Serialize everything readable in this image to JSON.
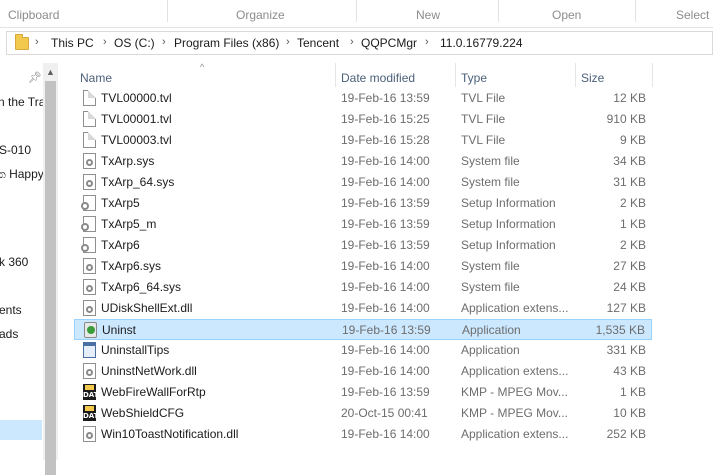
{
  "ribbon": {
    "groups": [
      "Clipboard",
      "Organize",
      "New",
      "Open",
      "Select"
    ]
  },
  "address": {
    "crumbs": [
      "This PC",
      "OS (C:)",
      "Program Files (x86)",
      "Tencent",
      "QQPCMgr",
      "11.0.16779.224"
    ]
  },
  "nav": {
    "items": [
      "n the Tra",
      "S-010",
      "ක Happy",
      "k 360",
      "ents",
      "ads"
    ]
  },
  "columns": {
    "name": "Name",
    "date": "Date modified",
    "type": "Type",
    "size": "Size"
  },
  "files": [
    {
      "name": "TVL00000.tvl",
      "date": "19-Feb-16 13:59",
      "type": "TVL File",
      "size": "12 KB",
      "icon": "document-icon"
    },
    {
      "name": "TVL00001.tvl",
      "date": "19-Feb-16 15:25",
      "type": "TVL File",
      "size": "910 KB",
      "icon": "document-icon"
    },
    {
      "name": "TVL00003.tvl",
      "date": "19-Feb-16 15:28",
      "type": "TVL File",
      "size": "9 KB",
      "icon": "document-icon"
    },
    {
      "name": "TxArp.sys",
      "date": "19-Feb-16 14:00",
      "type": "System file",
      "size": "34 KB",
      "icon": "system-file-icon"
    },
    {
      "name": "TxArp_64.sys",
      "date": "19-Feb-16 14:00",
      "type": "System file",
      "size": "31 KB",
      "icon": "system-file-icon"
    },
    {
      "name": "TxArp5",
      "date": "19-Feb-16 13:59",
      "type": "Setup Information",
      "size": "2 KB",
      "icon": "setup-info-icon"
    },
    {
      "name": "TxArp5_m",
      "date": "19-Feb-16 13:59",
      "type": "Setup Information",
      "size": "1 KB",
      "icon": "setup-info-icon"
    },
    {
      "name": "TxArp6",
      "date": "19-Feb-16 13:59",
      "type": "Setup Information",
      "size": "2 KB",
      "icon": "setup-info-icon"
    },
    {
      "name": "TxArp6.sys",
      "date": "19-Feb-16 14:00",
      "type": "System file",
      "size": "27 KB",
      "icon": "system-file-icon"
    },
    {
      "name": "TxArp6_64.sys",
      "date": "19-Feb-16 14:00",
      "type": "System file",
      "size": "24 KB",
      "icon": "system-file-icon"
    },
    {
      "name": "UDiskShellExt.dll",
      "date": "19-Feb-16 14:00",
      "type": "Application extens...",
      "size": "127 KB",
      "icon": "system-file-icon"
    },
    {
      "name": "Uninst",
      "date": "19-Feb-16 13:59",
      "type": "Application",
      "size": "1,535 KB",
      "icon": "uninstaller-icon",
      "selected": true
    },
    {
      "name": "UninstallTips",
      "date": "19-Feb-16 14:00",
      "type": "Application",
      "size": "331 KB",
      "icon": "application-icon"
    },
    {
      "name": "UninstNetWork.dll",
      "date": "19-Feb-16 14:00",
      "type": "Application extens...",
      "size": "43 KB",
      "icon": "system-file-icon"
    },
    {
      "name": "WebFireWallForRtp",
      "date": "19-Feb-16 13:59",
      "type": "KMP - MPEG Mov...",
      "size": "1 KB",
      "icon": "dat-file-icon"
    },
    {
      "name": "WebShieldCFG",
      "date": "20-Oct-15 00:41",
      "type": "KMP - MPEG Mov...",
      "size": "10 KB",
      "icon": "dat-file-icon"
    },
    {
      "name": "Win10ToastNotification.dll",
      "date": "19-Feb-16 14:00",
      "type": "Application extens...",
      "size": "252 KB",
      "icon": "system-file-icon"
    }
  ],
  "colors": {
    "selection_bg": "#cce8ff",
    "selection_border": "#99d1ff",
    "header_text": "#4c607a"
  }
}
